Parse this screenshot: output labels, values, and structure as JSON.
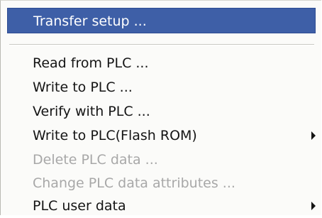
{
  "menu": {
    "items": [
      {
        "label": "Transfer setup ...",
        "state": "highlighted"
      },
      {
        "label": "Read from PLC ...",
        "state": "normal"
      },
      {
        "label": "Write to PLC ...",
        "state": "normal"
      },
      {
        "label": "Verify with PLC ...",
        "state": "normal"
      },
      {
        "label": "Write to PLC(Flash ROM)",
        "state": "normal",
        "submenu": true
      },
      {
        "label": "Delete PLC data ...",
        "state": "disabled"
      },
      {
        "label": "Change PLC data attributes ...",
        "state": "disabled"
      },
      {
        "label": "PLC user data",
        "state": "normal",
        "submenu": true
      }
    ],
    "colors": {
      "highlight": "#3e5fa7",
      "disabled_text": "#a8a8a8",
      "text": "#141414"
    }
  }
}
